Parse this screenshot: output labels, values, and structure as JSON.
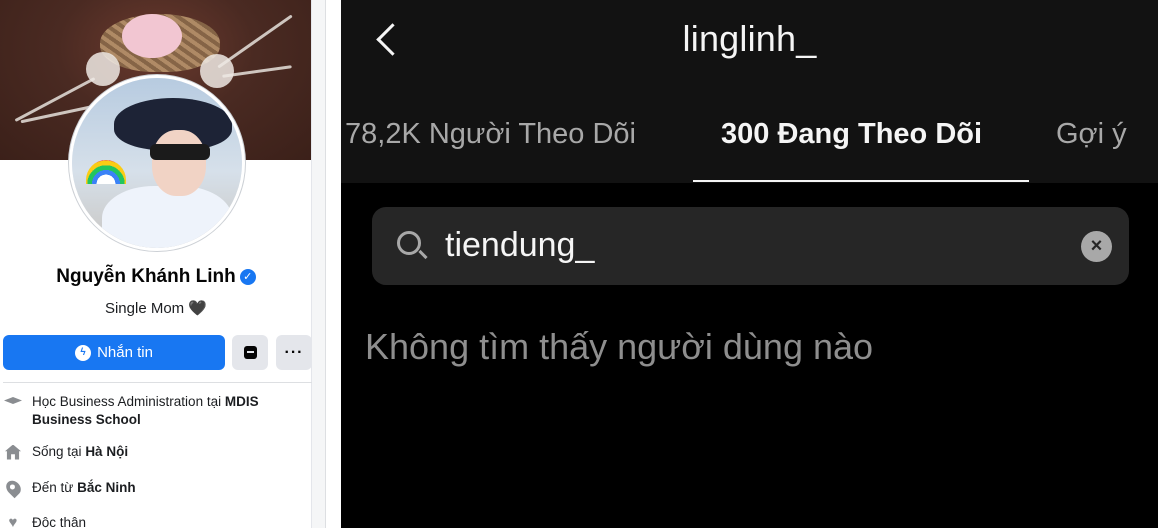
{
  "facebook": {
    "name": "Nguyễn Khánh Linh",
    "bio": "Single Mom 🖤",
    "message_button": "Nhắn tin",
    "more_button": "···",
    "info": {
      "education_prefix": "Học Business Administration tại",
      "education_bold": "MDIS Business School",
      "lives_prefix": "Sống tại",
      "lives_bold": "Hà Nội",
      "from_prefix": "Đến từ",
      "from_bold": "Bắc Ninh",
      "relationship": "Độc thân"
    },
    "icons": [
      "verified-badge-icon",
      "messenger-icon",
      "box-icon",
      "graduation-cap-icon",
      "home-icon",
      "location-pin-icon",
      "heart-icon"
    ]
  },
  "instagram": {
    "username": "linglinh_",
    "tabs": {
      "followers": "78,2K Người Theo Dõi",
      "following": "300 Đang Theo Dõi",
      "suggested": "Gợi ý"
    },
    "search": {
      "value": "tiendung_"
    },
    "empty_message": "Không tìm thấy người dùng nào",
    "colors": {
      "background": "#000000",
      "header": "#121212",
      "search_box": "#262626"
    },
    "icons": [
      "back-chevron-icon",
      "search-icon",
      "clear-icon"
    ]
  }
}
